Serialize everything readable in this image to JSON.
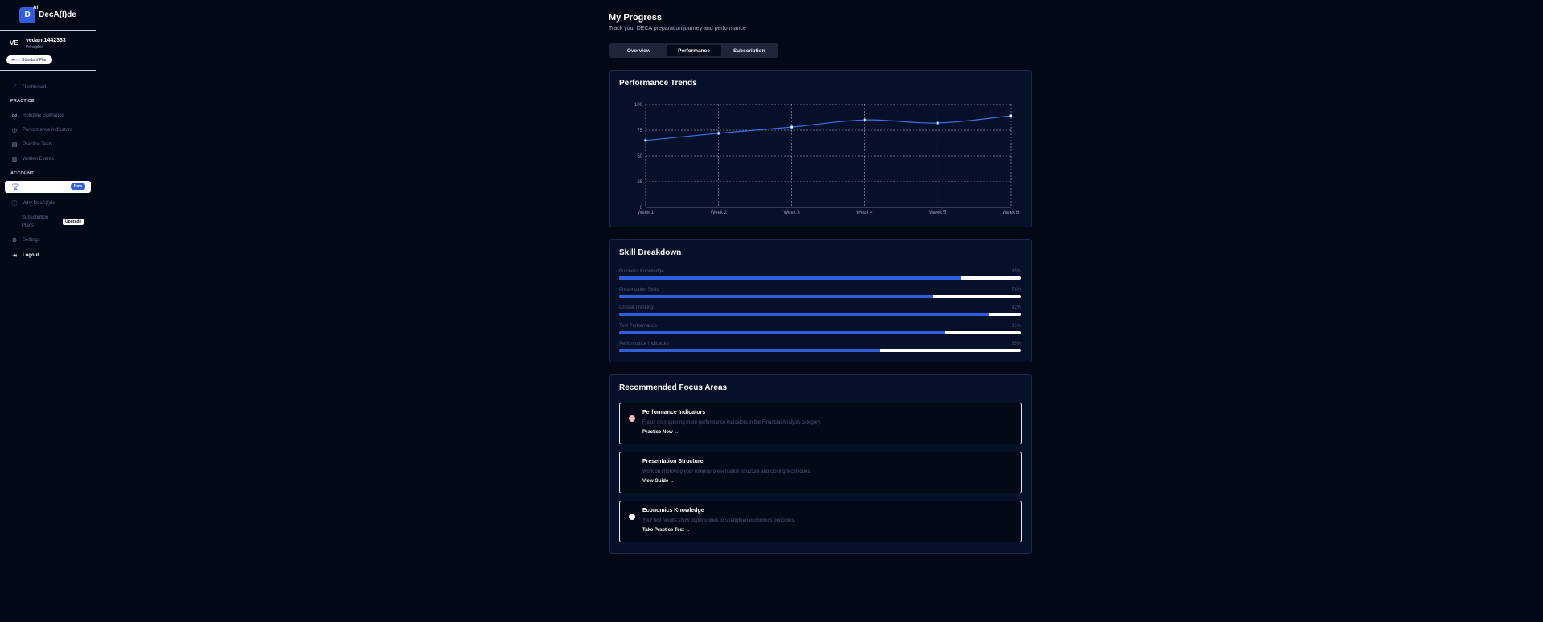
{
  "brand": {
    "logo_letter": "D",
    "logo_sup": "AI",
    "name": "DecA(I)de"
  },
  "user": {
    "initials": "VE",
    "name": "vedant1442333",
    "role": "Principles",
    "plan": "Standard Plan",
    "plan_dots": "●●○○○"
  },
  "nav": {
    "dashboard": "Dashboard",
    "practice_section": "PRACTICE",
    "roleplay": "Roleplay Scenarios",
    "performance_indicators": "Performance Indicators",
    "practice_tests": "Practice Tests",
    "written_events": "Written Events",
    "account_section": "ACCOUNT",
    "active_badge": "New",
    "why": "Why DecA(I)de",
    "subscription_line1": "Subscription",
    "subscription_line2": "Plans",
    "upgrade_badge": "Upgrade",
    "settings": "Settings",
    "logout": "Logout"
  },
  "page": {
    "title": "My Progress",
    "subtitle": "Track your DECA preparation journey and performance"
  },
  "tabs": [
    {
      "label": "Overview",
      "active": false
    },
    {
      "label": "Performance",
      "active": true
    },
    {
      "label": "Subscription",
      "active": false
    }
  ],
  "trends": {
    "title": "Performance Trends"
  },
  "chart_data": {
    "type": "line",
    "title": "Performance Trends",
    "categories": [
      "Week 1",
      "Week 2",
      "Week 3",
      "Week 4",
      "Week 5",
      "Week 6"
    ],
    "series": [
      {
        "values": [
          65,
          72,
          78,
          85,
          82,
          89
        ]
      }
    ],
    "yticks": [
      0,
      25,
      50,
      75,
      100
    ],
    "ylim": [
      0,
      100
    ],
    "grid": true,
    "line_color": "#3b6ff0"
  },
  "skills": {
    "title": "Skill Breakdown",
    "items": [
      {
        "label": "Business Knowledge",
        "pct": "85%",
        "value": 85
      },
      {
        "label": "Presentation Skills",
        "pct": "78%",
        "value": 78
      },
      {
        "label": "Critical Thinking",
        "pct": "92%",
        "value": 92
      },
      {
        "label": "Test Performance",
        "pct": "81%",
        "value": 81
      },
      {
        "label": "Performance Indicators",
        "pct": "65%",
        "value": 65
      }
    ]
  },
  "focus": {
    "title": "Recommended Focus Areas",
    "items": [
      {
        "title": "Performance Indicators",
        "desc": "Focus on mastering more performance indicators in the Financial Analysis category.",
        "link": "Practice Now →",
        "icon_color": "#f2b8c6"
      },
      {
        "title": "Presentation Structure",
        "desc": "Work on improving your roleplay presentation structure and closing techniques.",
        "link": "View Guide →",
        "icon_color": "#040918"
      },
      {
        "title": "Economics Knowledge",
        "desc": "Your test results show opportunities to strengthen economics principles.",
        "link": "Take Practice Test →",
        "icon_color": "#ffffff"
      }
    ]
  }
}
